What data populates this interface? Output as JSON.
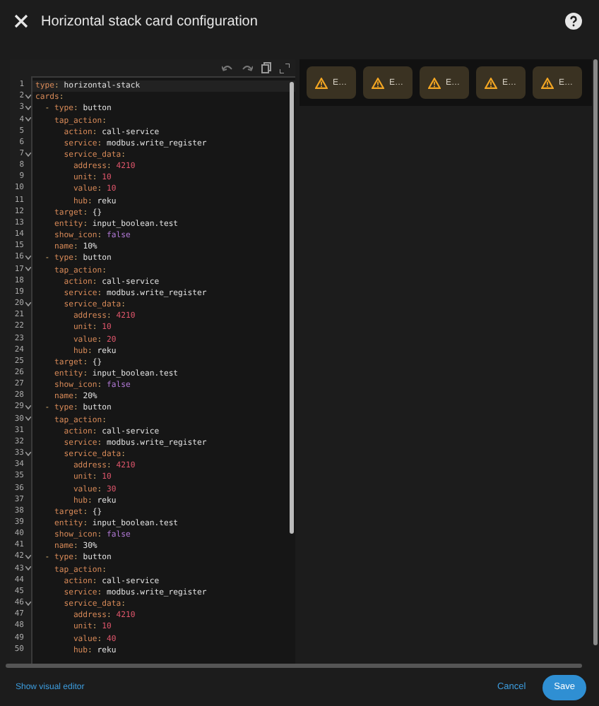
{
  "dialog": {
    "title": "Horizontal stack card configuration"
  },
  "editor": {
    "lines": [
      {
        "n": "1",
        "fold": false,
        "active": true,
        "parts": [
          {
            "kind": "key",
            "t": "type"
          },
          {
            "kind": "punct",
            "t": ":"
          },
          {
            "kind": "str",
            "t": " horizontal-stack"
          }
        ]
      },
      {
        "n": "2",
        "fold": true,
        "active": false,
        "parts": [
          {
            "kind": "key",
            "t": "cards"
          },
          {
            "kind": "punct",
            "t": ":"
          }
        ]
      },
      {
        "n": "3",
        "fold": true,
        "active": false,
        "parts": [
          {
            "kind": "punct",
            "t": "  - "
          },
          {
            "kind": "key",
            "t": "type"
          },
          {
            "kind": "punct",
            "t": ":"
          },
          {
            "kind": "str",
            "t": " button"
          }
        ]
      },
      {
        "n": "4",
        "fold": true,
        "active": false,
        "parts": [
          {
            "kind": "key",
            "t": "    tap_action"
          },
          {
            "kind": "punct",
            "t": ":"
          }
        ]
      },
      {
        "n": "5",
        "fold": false,
        "active": false,
        "parts": [
          {
            "kind": "key",
            "t": "      action"
          },
          {
            "kind": "punct",
            "t": ":"
          },
          {
            "kind": "str",
            "t": " call-service"
          }
        ]
      },
      {
        "n": "6",
        "fold": false,
        "active": false,
        "parts": [
          {
            "kind": "key",
            "t": "      service"
          },
          {
            "kind": "punct",
            "t": ":"
          },
          {
            "kind": "str",
            "t": " modbus.write_register"
          }
        ]
      },
      {
        "n": "7",
        "fold": true,
        "active": false,
        "parts": [
          {
            "kind": "key",
            "t": "      service_data"
          },
          {
            "kind": "punct",
            "t": ":"
          }
        ]
      },
      {
        "n": "8",
        "fold": false,
        "active": false,
        "parts": [
          {
            "kind": "key",
            "t": "        address"
          },
          {
            "kind": "punct",
            "t": ":"
          },
          {
            "kind": "num",
            "t": " 4210"
          }
        ]
      },
      {
        "n": "9",
        "fold": false,
        "active": false,
        "parts": [
          {
            "kind": "key",
            "t": "        unit"
          },
          {
            "kind": "punct",
            "t": ":"
          },
          {
            "kind": "num",
            "t": " 10"
          }
        ]
      },
      {
        "n": "10",
        "fold": false,
        "active": false,
        "parts": [
          {
            "kind": "key",
            "t": "        value"
          },
          {
            "kind": "punct",
            "t": ":"
          },
          {
            "kind": "num",
            "t": " 10"
          }
        ]
      },
      {
        "n": "11",
        "fold": false,
        "active": false,
        "parts": [
          {
            "kind": "key",
            "t": "        hub"
          },
          {
            "kind": "punct",
            "t": ":"
          },
          {
            "kind": "str",
            "t": " reku"
          }
        ]
      },
      {
        "n": "12",
        "fold": false,
        "active": false,
        "parts": [
          {
            "kind": "key",
            "t": "    target"
          },
          {
            "kind": "punct",
            "t": ":"
          },
          {
            "kind": "str",
            "t": " {}"
          }
        ]
      },
      {
        "n": "13",
        "fold": false,
        "active": false,
        "parts": [
          {
            "kind": "key",
            "t": "    entity"
          },
          {
            "kind": "punct",
            "t": ":"
          },
          {
            "kind": "str",
            "t": " input_boolean.test"
          }
        ]
      },
      {
        "n": "14",
        "fold": false,
        "active": false,
        "parts": [
          {
            "kind": "key",
            "t": "    show_icon"
          },
          {
            "kind": "punct",
            "t": ":"
          },
          {
            "kind": "bool",
            "t": " false"
          }
        ]
      },
      {
        "n": "15",
        "fold": false,
        "active": false,
        "parts": [
          {
            "kind": "key",
            "t": "    name"
          },
          {
            "kind": "punct",
            "t": ":"
          },
          {
            "kind": "str",
            "t": " 10%"
          }
        ]
      },
      {
        "n": "16",
        "fold": true,
        "active": false,
        "parts": [
          {
            "kind": "punct",
            "t": "  - "
          },
          {
            "kind": "key",
            "t": "type"
          },
          {
            "kind": "punct",
            "t": ":"
          },
          {
            "kind": "str",
            "t": " button"
          }
        ]
      },
      {
        "n": "17",
        "fold": true,
        "active": false,
        "parts": [
          {
            "kind": "key",
            "t": "    tap_action"
          },
          {
            "kind": "punct",
            "t": ":"
          }
        ]
      },
      {
        "n": "18",
        "fold": false,
        "active": false,
        "parts": [
          {
            "kind": "key",
            "t": "      action"
          },
          {
            "kind": "punct",
            "t": ":"
          },
          {
            "kind": "str",
            "t": " call-service"
          }
        ]
      },
      {
        "n": "19",
        "fold": false,
        "active": false,
        "parts": [
          {
            "kind": "key",
            "t": "      service"
          },
          {
            "kind": "punct",
            "t": ":"
          },
          {
            "kind": "str",
            "t": " modbus.write_register"
          }
        ]
      },
      {
        "n": "20",
        "fold": true,
        "active": false,
        "parts": [
          {
            "kind": "key",
            "t": "      service_data"
          },
          {
            "kind": "punct",
            "t": ":"
          }
        ]
      },
      {
        "n": "21",
        "fold": false,
        "active": false,
        "parts": [
          {
            "kind": "key",
            "t": "        address"
          },
          {
            "kind": "punct",
            "t": ":"
          },
          {
            "kind": "num",
            "t": " 4210"
          }
        ]
      },
      {
        "n": "22",
        "fold": false,
        "active": false,
        "parts": [
          {
            "kind": "key",
            "t": "        unit"
          },
          {
            "kind": "punct",
            "t": ":"
          },
          {
            "kind": "num",
            "t": " 10"
          }
        ]
      },
      {
        "n": "23",
        "fold": false,
        "active": false,
        "parts": [
          {
            "kind": "key",
            "t": "        value"
          },
          {
            "kind": "punct",
            "t": ":"
          },
          {
            "kind": "num",
            "t": " 20"
          }
        ]
      },
      {
        "n": "24",
        "fold": false,
        "active": false,
        "parts": [
          {
            "kind": "key",
            "t": "        hub"
          },
          {
            "kind": "punct",
            "t": ":"
          },
          {
            "kind": "str",
            "t": " reku"
          }
        ]
      },
      {
        "n": "25",
        "fold": false,
        "active": false,
        "parts": [
          {
            "kind": "key",
            "t": "    target"
          },
          {
            "kind": "punct",
            "t": ":"
          },
          {
            "kind": "str",
            "t": " {}"
          }
        ]
      },
      {
        "n": "26",
        "fold": false,
        "active": false,
        "parts": [
          {
            "kind": "key",
            "t": "    entity"
          },
          {
            "kind": "punct",
            "t": ":"
          },
          {
            "kind": "str",
            "t": " input_boolean.test"
          }
        ]
      },
      {
        "n": "27",
        "fold": false,
        "active": false,
        "parts": [
          {
            "kind": "key",
            "t": "    show_icon"
          },
          {
            "kind": "punct",
            "t": ":"
          },
          {
            "kind": "bool",
            "t": " false"
          }
        ]
      },
      {
        "n": "28",
        "fold": false,
        "active": false,
        "parts": [
          {
            "kind": "key",
            "t": "    name"
          },
          {
            "kind": "punct",
            "t": ":"
          },
          {
            "kind": "str",
            "t": " 20%"
          }
        ]
      },
      {
        "n": "29",
        "fold": true,
        "active": false,
        "parts": [
          {
            "kind": "punct",
            "t": "  - "
          },
          {
            "kind": "key",
            "t": "type"
          },
          {
            "kind": "punct",
            "t": ":"
          },
          {
            "kind": "str",
            "t": " button"
          }
        ]
      },
      {
        "n": "30",
        "fold": true,
        "active": false,
        "parts": [
          {
            "kind": "key",
            "t": "    tap_action"
          },
          {
            "kind": "punct",
            "t": ":"
          }
        ]
      },
      {
        "n": "31",
        "fold": false,
        "active": false,
        "parts": [
          {
            "kind": "key",
            "t": "      action"
          },
          {
            "kind": "punct",
            "t": ":"
          },
          {
            "kind": "str",
            "t": " call-service"
          }
        ]
      },
      {
        "n": "32",
        "fold": false,
        "active": false,
        "parts": [
          {
            "kind": "key",
            "t": "      service"
          },
          {
            "kind": "punct",
            "t": ":"
          },
          {
            "kind": "str",
            "t": " modbus.write_register"
          }
        ]
      },
      {
        "n": "33",
        "fold": true,
        "active": false,
        "parts": [
          {
            "kind": "key",
            "t": "      service_data"
          },
          {
            "kind": "punct",
            "t": ":"
          }
        ]
      },
      {
        "n": "34",
        "fold": false,
        "active": false,
        "parts": [
          {
            "kind": "key",
            "t": "        address"
          },
          {
            "kind": "punct",
            "t": ":"
          },
          {
            "kind": "num",
            "t": " 4210"
          }
        ]
      },
      {
        "n": "35",
        "fold": false,
        "active": false,
        "parts": [
          {
            "kind": "key",
            "t": "        unit"
          },
          {
            "kind": "punct",
            "t": ":"
          },
          {
            "kind": "num",
            "t": " 10"
          }
        ]
      },
      {
        "n": "36",
        "fold": false,
        "active": false,
        "parts": [
          {
            "kind": "key",
            "t": "        value"
          },
          {
            "kind": "punct",
            "t": ":"
          },
          {
            "kind": "num",
            "t": " 30"
          }
        ]
      },
      {
        "n": "37",
        "fold": false,
        "active": false,
        "parts": [
          {
            "kind": "key",
            "t": "        hub"
          },
          {
            "kind": "punct",
            "t": ":"
          },
          {
            "kind": "str",
            "t": " reku"
          }
        ]
      },
      {
        "n": "38",
        "fold": false,
        "active": false,
        "parts": [
          {
            "kind": "key",
            "t": "    target"
          },
          {
            "kind": "punct",
            "t": ":"
          },
          {
            "kind": "str",
            "t": " {}"
          }
        ]
      },
      {
        "n": "39",
        "fold": false,
        "active": false,
        "parts": [
          {
            "kind": "key",
            "t": "    entity"
          },
          {
            "kind": "punct",
            "t": ":"
          },
          {
            "kind": "str",
            "t": " input_boolean.test"
          }
        ]
      },
      {
        "n": "40",
        "fold": false,
        "active": false,
        "parts": [
          {
            "kind": "key",
            "t": "    show_icon"
          },
          {
            "kind": "punct",
            "t": ":"
          },
          {
            "kind": "bool",
            "t": " false"
          }
        ]
      },
      {
        "n": "41",
        "fold": false,
        "active": false,
        "parts": [
          {
            "kind": "key",
            "t": "    name"
          },
          {
            "kind": "punct",
            "t": ":"
          },
          {
            "kind": "str",
            "t": " 30%"
          }
        ]
      },
      {
        "n": "42",
        "fold": true,
        "active": false,
        "parts": [
          {
            "kind": "punct",
            "t": "  - "
          },
          {
            "kind": "key",
            "t": "type"
          },
          {
            "kind": "punct",
            "t": ":"
          },
          {
            "kind": "str",
            "t": " button"
          }
        ]
      },
      {
        "n": "43",
        "fold": true,
        "active": false,
        "parts": [
          {
            "kind": "key",
            "t": "    tap_action"
          },
          {
            "kind": "punct",
            "t": ":"
          }
        ]
      },
      {
        "n": "44",
        "fold": false,
        "active": false,
        "parts": [
          {
            "kind": "key",
            "t": "      action"
          },
          {
            "kind": "punct",
            "t": ":"
          },
          {
            "kind": "str",
            "t": " call-service"
          }
        ]
      },
      {
        "n": "45",
        "fold": false,
        "active": false,
        "parts": [
          {
            "kind": "key",
            "t": "      service"
          },
          {
            "kind": "punct",
            "t": ":"
          },
          {
            "kind": "str",
            "t": " modbus.write_register"
          }
        ]
      },
      {
        "n": "46",
        "fold": true,
        "active": false,
        "parts": [
          {
            "kind": "key",
            "t": "      service_data"
          },
          {
            "kind": "punct",
            "t": ":"
          }
        ]
      },
      {
        "n": "47",
        "fold": false,
        "active": false,
        "parts": [
          {
            "kind": "key",
            "t": "        address"
          },
          {
            "kind": "punct",
            "t": ":"
          },
          {
            "kind": "num",
            "t": " 4210"
          }
        ]
      },
      {
        "n": "48",
        "fold": false,
        "active": false,
        "parts": [
          {
            "kind": "key",
            "t": "        unit"
          },
          {
            "kind": "punct",
            "t": ":"
          },
          {
            "kind": "num",
            "t": " 10"
          }
        ]
      },
      {
        "n": "49",
        "fold": false,
        "active": false,
        "parts": [
          {
            "kind": "key",
            "t": "        value"
          },
          {
            "kind": "punct",
            "t": ":"
          },
          {
            "kind": "num",
            "t": " 40"
          }
        ]
      },
      {
        "n": "50",
        "fold": false,
        "active": false,
        "parts": [
          {
            "kind": "key",
            "t": "        hub"
          },
          {
            "kind": "punct",
            "t": ":"
          },
          {
            "kind": "str",
            "t": " reku"
          }
        ]
      }
    ]
  },
  "preview": {
    "cards": [
      {
        "label": "E…"
      },
      {
        "label": "E…"
      },
      {
        "label": "E…"
      },
      {
        "label": "E…"
      },
      {
        "label": "E…"
      }
    ]
  },
  "footer": {
    "link": "Show visual editor",
    "buttons": [
      {
        "label": "Cancel",
        "kind": "text"
      },
      {
        "label": "Save",
        "kind": "filled"
      }
    ]
  }
}
